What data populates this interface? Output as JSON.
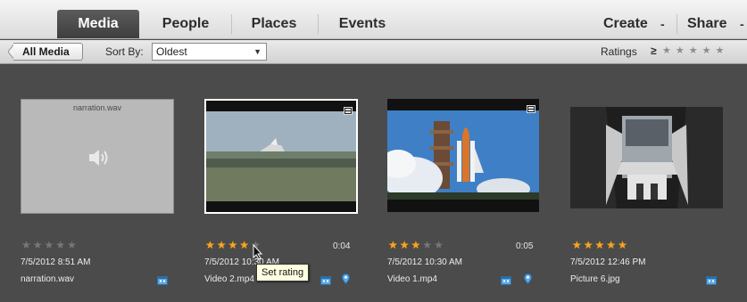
{
  "top_tabs": [
    {
      "label": "Media",
      "active": true
    },
    {
      "label": "People",
      "active": false
    },
    {
      "label": "Places",
      "active": false
    },
    {
      "label": "Events",
      "active": false
    }
  ],
  "top_menus": {
    "create": "Create",
    "share": "Share"
  },
  "filter_bar": {
    "back_label": "All Media",
    "sort_label": "Sort By:",
    "sort_value": "Oldest",
    "ratings_label": "Ratings",
    "ratings_op": "≥",
    "ratings_min": 0
  },
  "media": [
    {
      "type": "audio",
      "thumb_label": "narration.wav",
      "rating": 0,
      "duration": "",
      "date": "7/5/2012 8:51 AM",
      "filename": "narration.wav",
      "has_place": false
    },
    {
      "type": "video",
      "rating": 4,
      "duration": "0:04",
      "date": "7/5/2012 10:30 AM",
      "filename": "Video 2.mp4",
      "has_place": true,
      "selected": true
    },
    {
      "type": "video",
      "rating": 3,
      "duration": "0:05",
      "date": "7/5/2012 10:30 AM",
      "filename": "Video 1.mp4",
      "has_place": true
    },
    {
      "type": "photo",
      "rating": 5,
      "duration": "",
      "date": "7/5/2012 12:46 PM",
      "filename": "Picture 6.jpg",
      "has_place": false
    }
  ],
  "tooltip": "Set rating",
  "colors": {
    "star_on": "#f5a623",
    "star_off": "#777777",
    "accent_blue": "#5aa9e6"
  }
}
